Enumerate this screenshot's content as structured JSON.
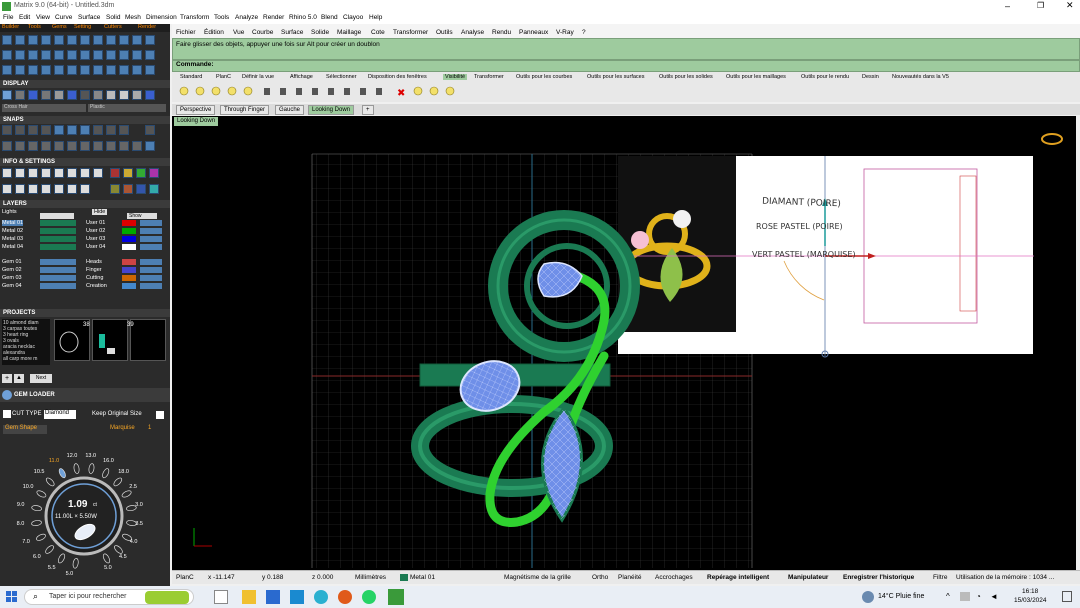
{
  "window": {
    "title": "Matrix 9.0 (64-bit) - Untitled.3dm"
  },
  "top_menu": [
    "File",
    "Edit",
    "View",
    "Curve",
    "Surface",
    "Solid",
    "Mesh",
    "Dimension",
    "Transform",
    "Tools",
    "Analyze",
    "Render",
    "Rhino 5.0",
    "Blend",
    "Clayoo",
    "Help"
  ],
  "sub_menu": [
    "Fichier",
    "Édition",
    "Vue",
    "Courbe",
    "Surface",
    "Solide",
    "Maillage",
    "Cote",
    "Transformer",
    "Outils",
    "Analyse",
    "Rendu",
    "Panneaux",
    "V-Ray",
    "?"
  ],
  "left_tabs": [
    "Builder",
    "Tools",
    "Gems",
    "Setting",
    "Cutters",
    "Render"
  ],
  "sections": {
    "display": "DISPLAY",
    "snaps": "SNAPS",
    "info": "INFO & SETTINGS",
    "layers": "LAYERS",
    "projects": "PROJECTS",
    "gem_loader": "GEM LOADER"
  },
  "display_selects": [
    "Cross Hair",
    "Plastic"
  ],
  "layers_left": [
    "Lights",
    "Metal 01",
    "Metal 02",
    "Metal 03",
    "Metal 04",
    "Gem 01",
    "Gem 02",
    "Gem 03",
    "Gem 04"
  ],
  "layers_right": [
    "Hide",
    "User 01",
    "User 02",
    "User 03",
    "User 04",
    "Heads",
    "Finger",
    "Cutting",
    "Creation"
  ],
  "layers_right_header2": "Show",
  "layer_colors_right": [
    "#000000",
    "#dd0000",
    "#00aa00",
    "#0000dd",
    "#ffffff",
    "#cc4444",
    "#4444cc",
    "#cc6600",
    "#4488cc"
  ],
  "projects": {
    "list": [
      "10 almond diam",
      "3 carpas toutes",
      "3 heart ring",
      "3 ovals",
      "aracia necklac",
      "alexandra",
      "all carp more m"
    ],
    "thumb_numbers": [
      "38",
      "39"
    ],
    "button": "Next"
  },
  "gem_loader": {
    "cut_type_label": "CUT TYPE",
    "cut_type_value": "Diamond",
    "keep_size": "Keep Original Size",
    "gem_shape_label": "Gem Shape",
    "gem_shape_value": "Marquise",
    "gem_shape_num": "1",
    "carat": "1.09",
    "carat_unit": "ct",
    "dims": "11.00L × 5.50W",
    "dial_numbers": [
      "5.0",
      "5.5",
      "6.0",
      "7.0",
      "8.0",
      "9.0",
      "10.0",
      "10.5",
      "11.0",
      "12.0",
      "13.0",
      "16.0",
      "18.0",
      "2.5",
      "3.0",
      "3.5",
      "4.0",
      "4.5",
      "5.0"
    ]
  },
  "command": {
    "message": "Faire glisser des objets, appuyer une fois sur Alt pour créer un doublon",
    "label": "Commande:"
  },
  "toolbar_tabs": [
    "Standard",
    "PlanC",
    "Définir la vue",
    "Affichage",
    "Sélectionner",
    "Disposition des fenêtres",
    "Visibilité",
    "Transformer",
    "Outils pour les courbes",
    "Outils pour les surfaces",
    "Outils pour les solides",
    "Outils pour les maillages",
    "Outils pour le rendu",
    "Dessin",
    "Nouveautés dans la V5"
  ],
  "viewport_tabs": [
    "Perspective",
    "Through Finger",
    "Gauche",
    "Looking Down"
  ],
  "viewport_name": "Looking Down",
  "sketch_text": [
    "DIAMANT (POIRE)",
    "ROSE PASTEL (POIRE)",
    "VERT PASTEL (MARQUISE)"
  ],
  "status": {
    "plane": "PlanC",
    "x": "x -11.147",
    "y": "y 0.188",
    "z": "z 0.000",
    "units": "Millimètres",
    "layer": "Metal 01",
    "items": [
      "Magnétisme de la grille",
      "Ortho",
      "Planéité",
      "Accrochages",
      "Repérage intelligent",
      "Manipulateur",
      "Enregistrer l'historique",
      "Filtre",
      "Utilisation de la mémoire : 1034 ..."
    ]
  },
  "taskbar": {
    "search_placeholder": "Taper ici pour rechercher",
    "weather": "14°C  Pluie fine",
    "time": "16:18",
    "date": "15/03/2024"
  },
  "colors": {
    "command_green": "#9ecb9e",
    "viewport_bg": "#000000",
    "ring_green": "#1a7a52",
    "bright_green": "#2fd12f",
    "gem_blue": "#6f8fe8"
  }
}
